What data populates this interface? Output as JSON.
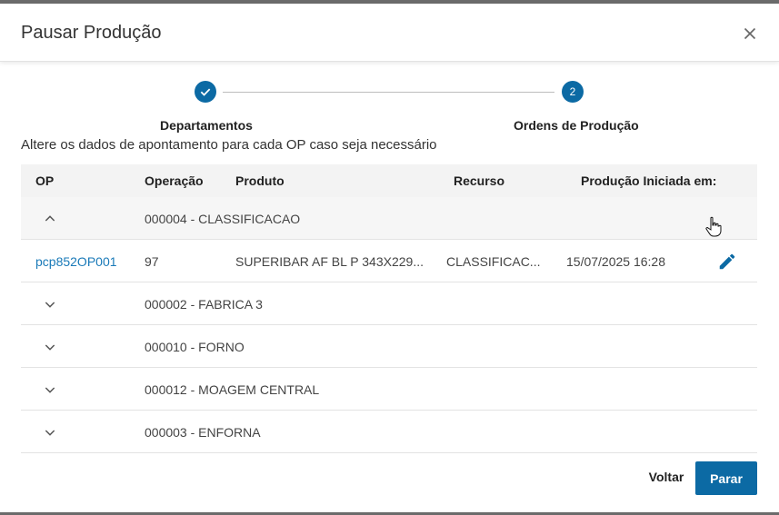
{
  "dialog": {
    "title": "Pausar Produção"
  },
  "stepper": {
    "steps": [
      {
        "label": "Departamentos",
        "state": "done"
      },
      {
        "label": "Ordens de Produção",
        "number": "2",
        "state": "active"
      }
    ]
  },
  "instructions": "Altere os dados de apontamento para cada OP caso seja necessário",
  "table": {
    "columns": [
      "OP",
      "Operação",
      "Produto",
      "Recurso",
      "Produção Iniciada em:"
    ],
    "groups": [
      {
        "label": "000004 - CLASSIFICACAO",
        "expanded": true,
        "rows": [
          {
            "op": "pcp852OP001",
            "operacao": "97",
            "produto": "SUPERIBAR AF BL P 343X229...",
            "recurso": "CLASSIFICAC...",
            "inicio": "15/07/2025 16:28"
          }
        ]
      },
      {
        "label": "000002 - FABRICA 3",
        "expanded": false
      },
      {
        "label": "000010 - FORNO",
        "expanded": false
      },
      {
        "label": "000012 - MOAGEM CENTRAL",
        "expanded": false
      },
      {
        "label": "000003 - ENFORNA",
        "expanded": false
      }
    ]
  },
  "actions": {
    "back_label": "Voltar",
    "stop_label": "Parar"
  },
  "colors": {
    "primary": "#0c6aa4",
    "link": "#1a7ab8"
  },
  "icons": {
    "close": "close-icon",
    "done": "check-icon",
    "expanded": "chevron-up-icon",
    "collapsed": "chevron-down-icon",
    "edit": "pencil-icon"
  }
}
